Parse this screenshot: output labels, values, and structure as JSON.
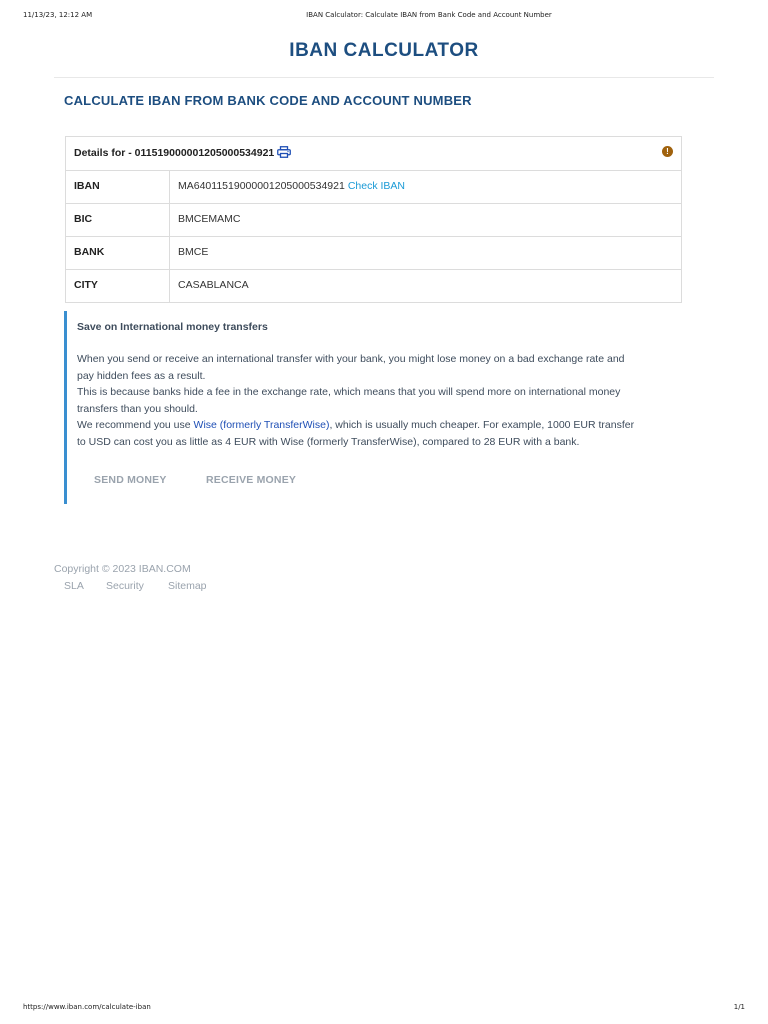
{
  "print_header": {
    "datetime": "11/13/23, 12:12 AM",
    "title": "IBAN Calculator: Calculate IBAN from Bank Code and Account Number"
  },
  "print_footer": {
    "url": "https://www.iban.com/calculate-iban",
    "page": "1/1"
  },
  "header": {
    "title": "IBAN CALCULATOR"
  },
  "main": {
    "heading": "CALCULATE IBAN FROM BANK CODE AND ACCOUNT NUMBER",
    "details": {
      "header_text": "Details for - 011519000001205000534921",
      "print_icon": "printer-icon",
      "info_icon": "exclamation-circle-icon",
      "info_icon_glyph": "!",
      "info_icon_color": "#a0620d",
      "rows": [
        {
          "label": "IBAN",
          "value": "MA64011519000001205000534921",
          "link": "Check IBAN"
        },
        {
          "label": "BIC",
          "value": "BMCEMAMC"
        },
        {
          "label": "BANK",
          "value": "BMCE"
        },
        {
          "label": "CITY",
          "value": "CASABLANCA"
        }
      ]
    },
    "promo": {
      "title": "Save on International money transfers",
      "paragraph1": "When you send or receive an international transfer with your bank, you might lose money on a bad exchange rate and pay hidden fees as a result.",
      "paragraph2": "This is because banks hide a fee in the exchange rate, which means that you will spend more on international money transfers than you should.",
      "paragraph3_before": "We recommend you use ",
      "paragraph3_link": "Wise (formerly TransferWise)",
      "paragraph3_after": ", which is usually much cheaper. For example, 1000 EUR transfer to USD can cost you as little as 4 EUR with Wise (formerly TransferWise), compared to 28 EUR with a bank.",
      "send_button": "SEND MONEY",
      "receive_button": "RECEIVE MONEY",
      "accent_color": "#3a8fd0"
    }
  },
  "footer": {
    "copyright": "Copyright © 2023 IBAN.COM",
    "links": [
      "SLA",
      "Security",
      "Sitemap"
    ]
  },
  "colors": {
    "brand": "#1d4e80",
    "link": "#1a9ad6",
    "promo_link": "#1f4fb5",
    "muted": "#9aa3ad"
  }
}
